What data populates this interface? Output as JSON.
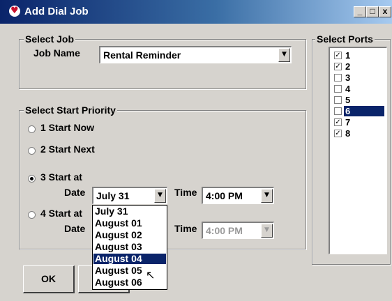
{
  "window": {
    "title": "Add Dial Job"
  },
  "title_buttons": {
    "minimize": "_",
    "maximize": "□",
    "close": "x"
  },
  "select_job": {
    "group_title": "Select Job",
    "job_name_label": "Job Name",
    "job_name_value": "Rental Reminder"
  },
  "priority": {
    "group_title": "Select Start Priority",
    "options": [
      "1 Start Now",
      "2 Start Next",
      "3 Start at",
      "4 Start at"
    ],
    "selected_index": 2,
    "date_label": "Date",
    "time_label": "Time",
    "date_value": "July 31",
    "time_value_3": "4:00 PM",
    "time_value_4": "4:00 PM"
  },
  "date_dropdown": {
    "options": [
      "July 31",
      "August 01",
      "August 02",
      "August 03",
      "August 04",
      "August 05",
      "August 06"
    ],
    "highlighted_index": 4
  },
  "ports": {
    "group_title": "Select Ports",
    "items": [
      {
        "label": "1",
        "checked": true
      },
      {
        "label": "2",
        "checked": true
      },
      {
        "label": "3",
        "checked": false
      },
      {
        "label": "4",
        "checked": false
      },
      {
        "label": "5",
        "checked": false
      },
      {
        "label": "6",
        "checked": false
      },
      {
        "label": "7",
        "checked": true
      },
      {
        "label": "8",
        "checked": true
      }
    ],
    "selected_index": 5
  },
  "buttons": {
    "ok": "OK",
    "cancel": "C"
  },
  "colors": {
    "selection": "#0a246a",
    "face": "#d6d3ce"
  }
}
